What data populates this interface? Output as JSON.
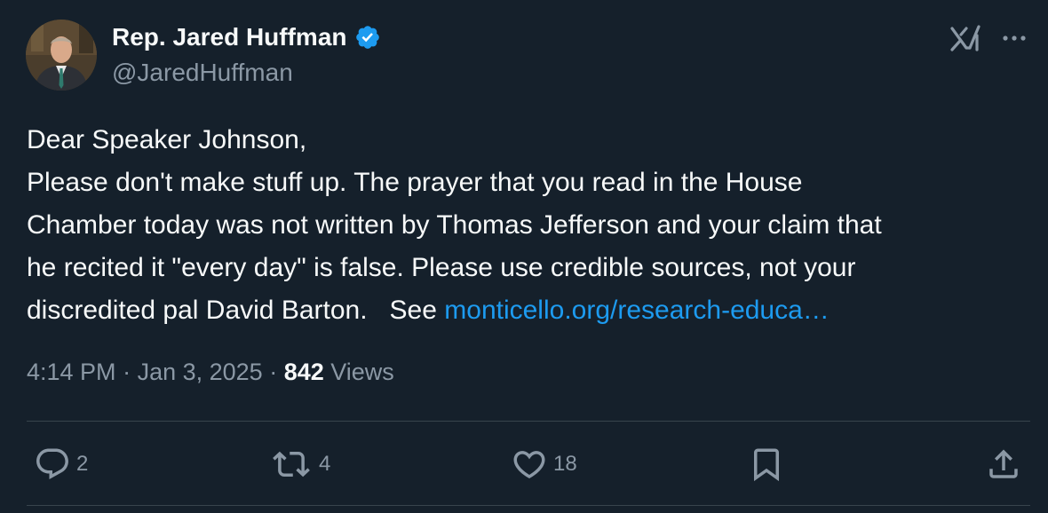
{
  "author": {
    "name": "Rep. Jared Huffman",
    "handle": "@JaredHuffman",
    "verified": true
  },
  "tweet": {
    "lines": [
      "Dear Speaker Johnson,",
      "Please don't make stuff up.  The prayer that you read in the House",
      "Chamber today was not written by Thomas Jefferson and your claim that",
      "he recited it \"every day\" is false.  Please use credible sources, not your",
      "discredited pal David Barton.   See "
    ],
    "link_text": "monticello.org/research-educa…"
  },
  "meta": {
    "time": "4:14 PM",
    "separator": " · ",
    "date": "Jan 3, 2025",
    "views_count": "842",
    "views_label": " Views"
  },
  "actions": {
    "replies": "2",
    "reposts": "4",
    "likes": "18"
  },
  "colors": {
    "background": "#15202b",
    "text": "#f7f9f9",
    "secondary": "#8b98a5",
    "link": "#1d9bf0",
    "verified": "#1d9bf0",
    "divider": "#38444d"
  },
  "icons": [
    "verified-badge-icon",
    "grok-icon",
    "more-icon",
    "reply-icon",
    "repost-icon",
    "like-icon",
    "bookmark-icon",
    "share-icon"
  ]
}
